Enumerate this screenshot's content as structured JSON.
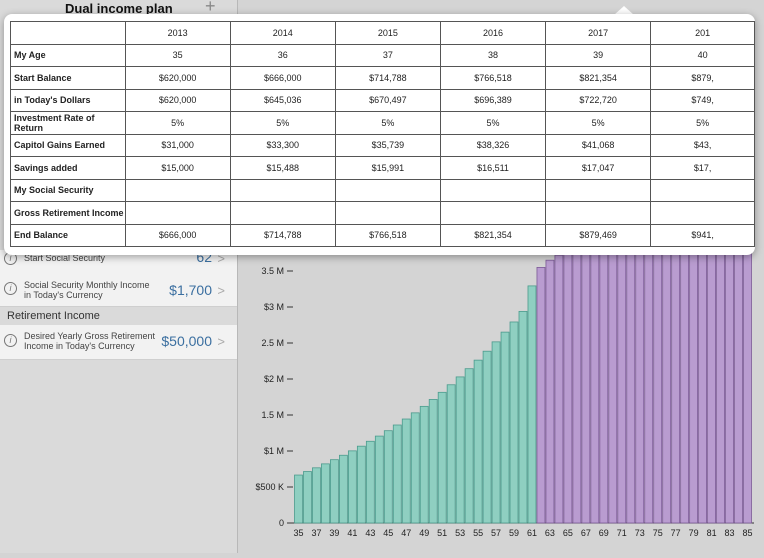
{
  "sidebar": {
    "title": "Dual income plan",
    "add_glyph": "+",
    "start_social_security": {
      "label": "Start Social Security",
      "value": "62"
    },
    "ss_monthly": {
      "label_1": "Social Security Monthly Income",
      "label_2": "in Today's Currency",
      "value": "$1,700"
    },
    "retirement_section": "Retirement Income",
    "desired_income": {
      "label_1": "Desired Yearly Gross Retirement",
      "label_2": "Income in Today's Currency",
      "value": "$50,000"
    },
    "chevron": ">",
    "info_glyph": "i"
  },
  "table": {
    "years": [
      "2013",
      "2014",
      "2015",
      "2016",
      "2017",
      "201"
    ],
    "rows": [
      {
        "label": "My Age",
        "values": [
          "35",
          "36",
          "37",
          "38",
          "39",
          "40"
        ]
      },
      {
        "label": "Start Balance",
        "values": [
          "$620,000",
          "$666,000",
          "$714,788",
          "$766,518",
          "$821,354",
          "$879,"
        ]
      },
      {
        "label": "in Today's Dollars",
        "values": [
          "$620,000",
          "$645,036",
          "$670,497",
          "$696,389",
          "$722,720",
          "$749,"
        ]
      },
      {
        "label": "Investment Rate of Return",
        "values": [
          "5%",
          "5%",
          "5%",
          "5%",
          "5%",
          "5%"
        ]
      },
      {
        "label": "Capitol Gains Earned",
        "values": [
          "$31,000",
          "$33,300",
          "$35,739",
          "$38,326",
          "$41,068",
          "$43,"
        ]
      },
      {
        "label": "Savings added",
        "values": [
          "$15,000",
          "$15,488",
          "$15,991",
          "$16,511",
          "$17,047",
          "$17,"
        ]
      },
      {
        "label": "My Social Security",
        "values": [
          "",
          "",
          "",
          "",
          "",
          ""
        ]
      },
      {
        "label": "Gross Retirement Income",
        "values": [
          "",
          "",
          "",
          "",
          "",
          ""
        ]
      },
      {
        "label": "End Balance",
        "values": [
          "$666,000",
          "$714,788",
          "$766,518",
          "$821,354",
          "$879,469",
          "$941,"
        ]
      }
    ]
  },
  "chart_data": {
    "type": "bar",
    "x_tick_labels": [
      "35",
      "37",
      "39",
      "41",
      "43",
      "45",
      "47",
      "49",
      "51",
      "53",
      "55",
      "57",
      "59",
      "61",
      "63",
      "65",
      "67",
      "69",
      "71",
      "73",
      "75",
      "77",
      "79",
      "81",
      "83",
      "85"
    ],
    "y_tick_labels": [
      "0",
      "$500 K",
      "$1 M",
      "1.5 M",
      "$2 M",
      "2.5 M",
      "$3 M",
      "3.5 M"
    ],
    "ylim": [
      0,
      3750000
    ],
    "ages": [
      35,
      36,
      37,
      38,
      39,
      40,
      41,
      42,
      43,
      44,
      45,
      46,
      47,
      48,
      49,
      50,
      51,
      52,
      53,
      54,
      55,
      56,
      57,
      58,
      59,
      60,
      61,
      62,
      63,
      64,
      65,
      66,
      67,
      68,
      69,
      70,
      71,
      72,
      73,
      74,
      75,
      76,
      77,
      78,
      79,
      80,
      81,
      82,
      83,
      84,
      85
    ],
    "series": [
      {
        "values": [
          666000,
          714788,
          766518,
          821354,
          879469,
          941000,
          1002000,
          1067000,
          1135000,
          1207000,
          1282000,
          1361000,
          1444000,
          1530000,
          1620000,
          1716000,
          1815000,
          1920000,
          2029000,
          2143000,
          2262000,
          2386000,
          2516000,
          2651000,
          2792000,
          2939000,
          3293000,
          null,
          null,
          null,
          null,
          null,
          null,
          null,
          null,
          null,
          null,
          null,
          null,
          null,
          null,
          null,
          null,
          null,
          null,
          null,
          null,
          null,
          null,
          null,
          null
        ],
        "color": "#8fcfc1"
      },
      {
        "values": [
          null,
          null,
          null,
          null,
          null,
          null,
          null,
          null,
          null,
          null,
          null,
          null,
          null,
          null,
          null,
          null,
          null,
          null,
          null,
          null,
          null,
          null,
          null,
          null,
          null,
          null,
          null,
          3550000,
          3650000,
          3720000,
          3750000,
          3750000,
          3750000,
          3750000,
          3750000,
          3750000,
          3750000,
          3750000,
          3750000,
          3750000,
          3750000,
          3750000,
          3750000,
          3750000,
          3750000,
          3750000,
          3750000,
          3750000,
          3750000,
          3750000,
          3750000
        ],
        "color": "#b99cd0"
      }
    ],
    "colors": {
      "teal": "#8fcfc1",
      "teal_stroke": "#4c9b8d",
      "purple": "#b99cd0",
      "purple_stroke": "#7c5b97"
    }
  }
}
